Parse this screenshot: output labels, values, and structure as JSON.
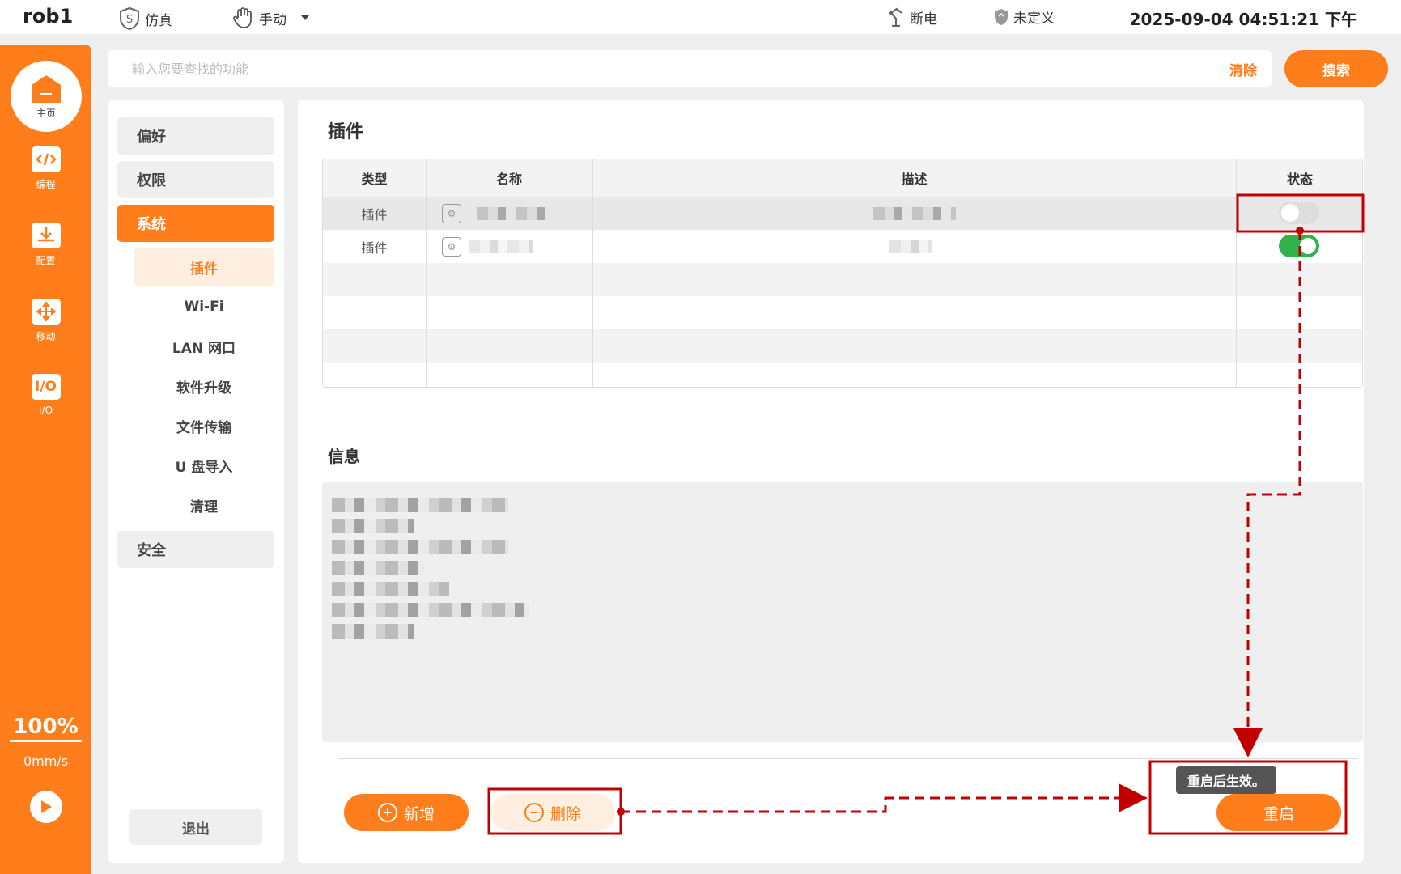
{
  "topbar": {
    "robot": "rob1",
    "mode": "仿真",
    "control": "手动",
    "power": "断电",
    "safety": "未定义",
    "datetime": "2025-09-04 04:51:21 下午"
  },
  "leftnav": {
    "home": "主页",
    "items": [
      {
        "label": "编程",
        "icon": "code-icon"
      },
      {
        "label": "配置",
        "icon": "download-icon"
      },
      {
        "label": "移动",
        "icon": "move-icon"
      },
      {
        "label": "I/O",
        "icon": "io-icon",
        "glyph": "I/O"
      }
    ],
    "speed_percent": "100%",
    "speed_value": "0mm/s",
    "bottom_marks": [
      "?",
      "?",
      "?",
      "?"
    ]
  },
  "search": {
    "placeholder": "输入您要查找的功能",
    "clear_label": "清除",
    "search_label": "搜索"
  },
  "menu": {
    "preference": "偏好",
    "permission": "权限",
    "system": "系统",
    "sub": [
      "插件",
      "Wi-Fi",
      "LAN 网口",
      "软件升级",
      "文件传输",
      "U 盘导入",
      "清理"
    ],
    "security": "安全",
    "exit": "退出"
  },
  "main": {
    "plugins_title": "插件",
    "columns": [
      "类型",
      "名称",
      "描述",
      "状态"
    ],
    "rows": [
      {
        "type": "插件",
        "enabled": false
      },
      {
        "type": "插件",
        "enabled": true
      }
    ],
    "info_title": "信息",
    "add_label": "新增",
    "delete_label": "删除",
    "restart_label": "重启",
    "tooltip": "重启后生效。"
  },
  "colors": {
    "accent": "#ff7d1a",
    "toggle_on": "#2fb34a",
    "annotation": "#c00000"
  }
}
